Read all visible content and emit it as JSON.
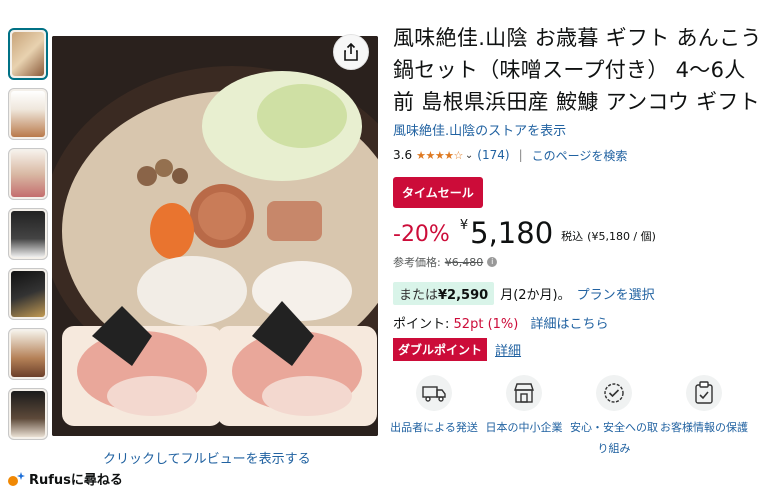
{
  "gallery": {
    "thumbnail_count": 7,
    "fullview_label": "クリックしてフルビューを表示する",
    "rufus_label": "Rufusに尋ねる"
  },
  "product": {
    "title": "風味絶佳.山陰 お歳暮 ギフト あんこう鍋セット（味噌スープ付き） 4〜6人前 島根県浜田産 鮟鱇 アンコウ ギフト",
    "store_link": "風味絶佳.山陰のストアを表示",
    "rating": "3.6",
    "stars": "★★★★☆",
    "rating_count": "(174)",
    "rating_separator": "|",
    "search_page": "このページを検索"
  },
  "pricing": {
    "sale_badge": "タイムセール",
    "discount": "-20%",
    "yen_symbol": "¥",
    "price": "5,180",
    "tax_label": "税込",
    "unit_price": "(¥5,180 / 個)",
    "reference_label": "参考価格:",
    "reference_price": "¥6,480",
    "installment_prefix": "または",
    "installment_amount": "¥2,590",
    "installment_term": "月(2か月)。",
    "plan_link": "プランを選択",
    "points_label": "ポイント:",
    "points_value": "52pt",
    "points_rate": "(1%)",
    "points_link": "詳細はこちら",
    "double_point_badge": "ダブルポイント",
    "double_point_link": "詳細"
  },
  "features": [
    {
      "icon": "delivery-truck-icon",
      "label": "出品者による発送"
    },
    {
      "icon": "storefront-icon",
      "label": "日本の中小企業"
    },
    {
      "icon": "verified-badge-icon",
      "label": "安心・安全への取り組み"
    },
    {
      "icon": "clipboard-check-icon",
      "label": "お客様情報の保護"
    }
  ],
  "colors": {
    "link": "#2162a1",
    "sale_red": "#cc0c39",
    "star": "#de7921",
    "installment_bg": "#d9f4e9"
  }
}
